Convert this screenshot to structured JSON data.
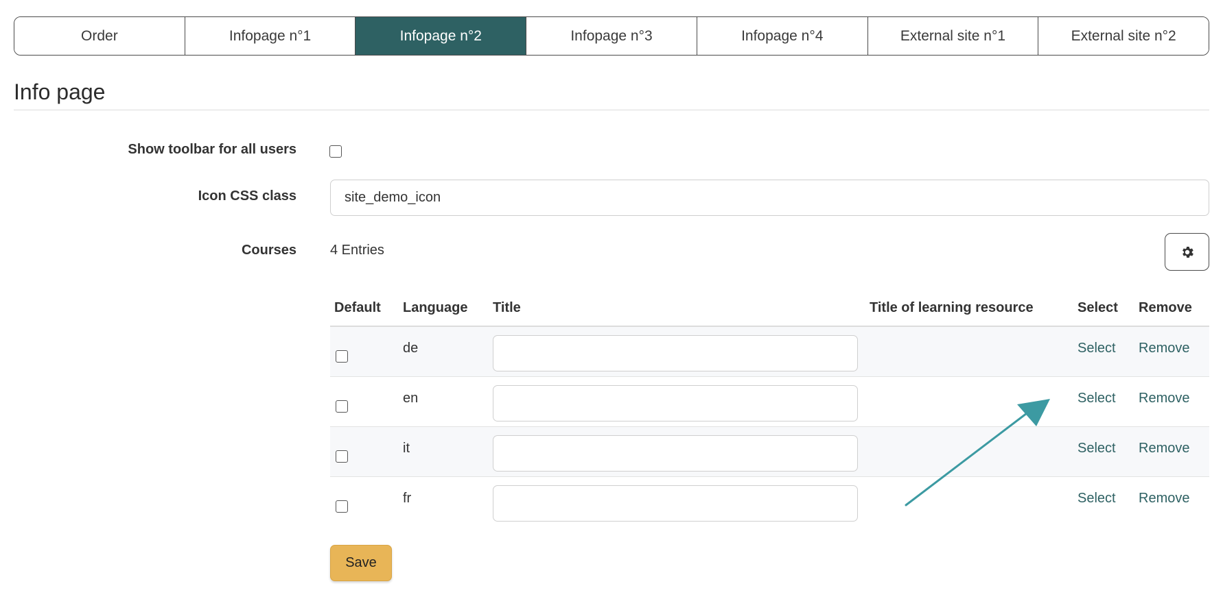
{
  "tabs": [
    {
      "label": "Order",
      "active": false
    },
    {
      "label": "Infopage n°1",
      "active": false
    },
    {
      "label": "Infopage n°2",
      "active": true
    },
    {
      "label": "Infopage n°3",
      "active": false
    },
    {
      "label": "Infopage n°4",
      "active": false
    },
    {
      "label": "External site n°1",
      "active": false
    },
    {
      "label": "External site n°2",
      "active": false
    }
  ],
  "page_title": "Info page",
  "form": {
    "show_toolbar_label": "Show toolbar for all users",
    "show_toolbar_checked": false,
    "icon_css_label": "Icon CSS class",
    "icon_css_value": "site_demo_icon",
    "courses_label": "Courses",
    "courses_entries": "4 Entries"
  },
  "table": {
    "headers": {
      "default": "Default",
      "language": "Language",
      "title": "Title",
      "title_resource": "Title of learning resource",
      "select": "Select",
      "remove": "Remove"
    },
    "rows": [
      {
        "language": "de",
        "title": "",
        "resource": "",
        "select": "Select",
        "remove": "Remove",
        "default": false
      },
      {
        "language": "en",
        "title": "",
        "resource": "",
        "select": "Select",
        "remove": "Remove",
        "default": false
      },
      {
        "language": "it",
        "title": "",
        "resource": "",
        "select": "Select",
        "remove": "Remove",
        "default": false
      },
      {
        "language": "fr",
        "title": "",
        "resource": "",
        "select": "Select",
        "remove": "Remove",
        "default": false
      }
    ]
  },
  "save_label": "Save",
  "colors": {
    "accent": "#2e6163",
    "save_button": "#e8b557",
    "annotation_arrow": "#3c9aa2"
  },
  "icons": {
    "settings": "gear-icon",
    "annotation": "arrow-annotation-icon"
  }
}
